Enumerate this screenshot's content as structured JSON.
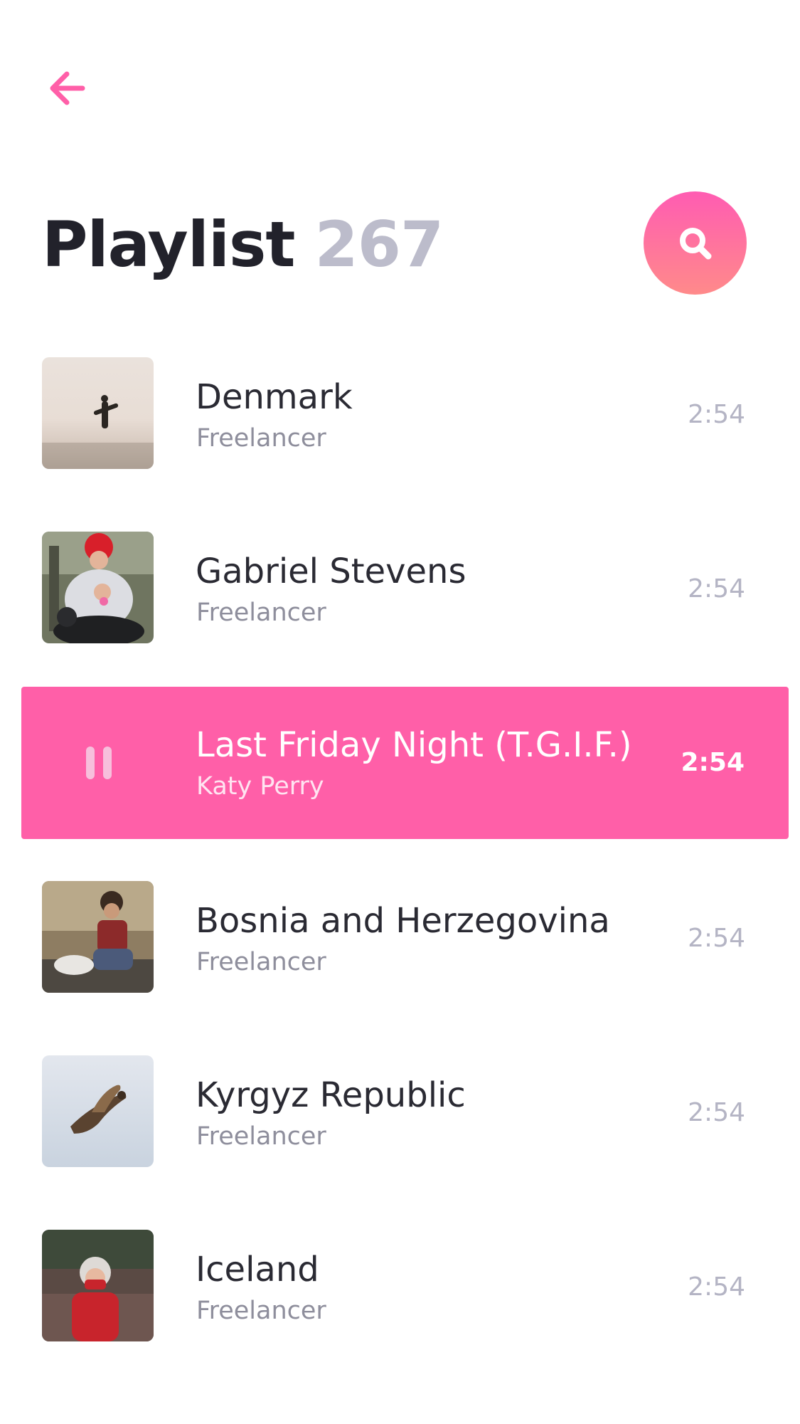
{
  "header": {
    "back_icon": "arrow-left-icon",
    "title": "Playlist",
    "count": "267",
    "search_icon": "search-icon",
    "accent_color": "#ff5fa8"
  },
  "tracks": [
    {
      "name": "Denmark",
      "artist": "Freelancer",
      "duration": "2:54",
      "active": false,
      "thumb": "surfer-on-beach"
    },
    {
      "name": "Gabriel Stevens",
      "artist": "Freelancer",
      "duration": "2:54",
      "active": false,
      "thumb": "motorcycle-rider"
    },
    {
      "name": "Last Friday Night (T.G.I.F.)",
      "artist": "Katy Perry",
      "duration": "2:54",
      "active": true,
      "control_icon": "pause-icon"
    },
    {
      "name": "Bosnia and Herzegovina",
      "artist": "Freelancer",
      "duration": "2:54",
      "active": false,
      "thumb": "child-sitting"
    },
    {
      "name": "Kyrgyz Republic",
      "artist": "Freelancer",
      "duration": "2:54",
      "active": false,
      "thumb": "bird-in-flight"
    },
    {
      "name": "Iceland",
      "artist": "Freelancer",
      "duration": "2:54",
      "active": false,
      "thumb": "child-in-red"
    }
  ]
}
